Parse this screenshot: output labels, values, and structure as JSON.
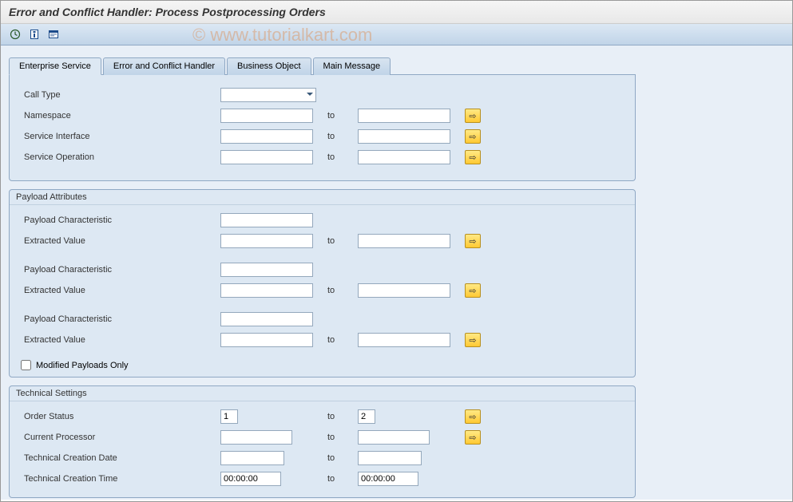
{
  "title": "Error and Conflict Handler: Process Postprocessing Orders",
  "watermark": "© www.tutorialkart.com",
  "tabs": [
    {
      "label": "Enterprise Service",
      "active": true
    },
    {
      "label": "Error and Conflict Handler",
      "active": false
    },
    {
      "label": "Business Object",
      "active": false
    },
    {
      "label": "Main Message",
      "active": false
    }
  ],
  "enterpriseService": {
    "callType": {
      "label": "Call Type",
      "value": ""
    },
    "namespace": {
      "label": "Namespace",
      "from": "",
      "to_label": "to",
      "to": ""
    },
    "serviceInterface": {
      "label": "Service Interface",
      "from": "",
      "to_label": "to",
      "to": ""
    },
    "serviceOperation": {
      "label": "Service Operation",
      "from": "",
      "to_label": "to",
      "to": ""
    }
  },
  "payloadAttributes": {
    "title": "Payload Attributes",
    "groups": [
      {
        "characteristic": {
          "label": "Payload Characteristic",
          "value": ""
        },
        "extractedValue": {
          "label": "Extracted Value",
          "from": "",
          "to_label": "to",
          "to": ""
        }
      },
      {
        "characteristic": {
          "label": "Payload Characteristic",
          "value": ""
        },
        "extractedValue": {
          "label": "Extracted Value",
          "from": "",
          "to_label": "to",
          "to": ""
        }
      },
      {
        "characteristic": {
          "label": "Payload Characteristic",
          "value": ""
        },
        "extractedValue": {
          "label": "Extracted Value",
          "from": "",
          "to_label": "to",
          "to": ""
        }
      }
    ],
    "modifiedOnly": {
      "label": "Modified Payloads Only",
      "checked": false
    }
  },
  "technicalSettings": {
    "title": "Technical Settings",
    "orderStatus": {
      "label": "Order Status",
      "from": "1",
      "to_label": "to",
      "to": "2"
    },
    "currentProcessor": {
      "label": "Current Processor",
      "from": "",
      "to_label": "to",
      "to": ""
    },
    "technicalCreationDate": {
      "label": "Technical Creation Date",
      "from": "",
      "to_label": "to",
      "to": ""
    },
    "technicalCreationTime": {
      "label": "Technical Creation Time",
      "from": "00:00:00",
      "to_label": "to",
      "to": "00:00:00"
    }
  }
}
